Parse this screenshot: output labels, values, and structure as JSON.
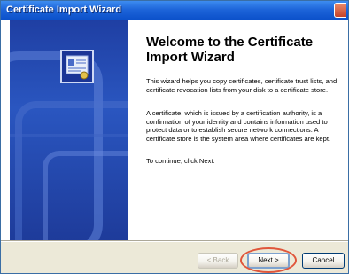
{
  "window": {
    "title": "Certificate Import Wizard"
  },
  "content": {
    "heading": "Welcome to the Certificate Import Wizard",
    "paragraphs": [
      "This wizard helps you copy certificates, certificate trust lists, and certificate revocation lists from your disk to a certificate store.",
      "A certificate, which is issued by a certification authority, is a confirmation of your identity and contains information used to protect data or to establish secure network connections. A certificate store is the system area where certificates are kept.",
      "To continue, click Next."
    ]
  },
  "buttons": {
    "back": "< Back",
    "next": "Next >",
    "cancel": "Cancel"
  },
  "icons": {
    "banner": "certificate-icon",
    "close": "close-icon"
  },
  "colors": {
    "titlebar": "#1d64d9",
    "banner": "#2a56c0",
    "highlight": "#e0563b"
  }
}
